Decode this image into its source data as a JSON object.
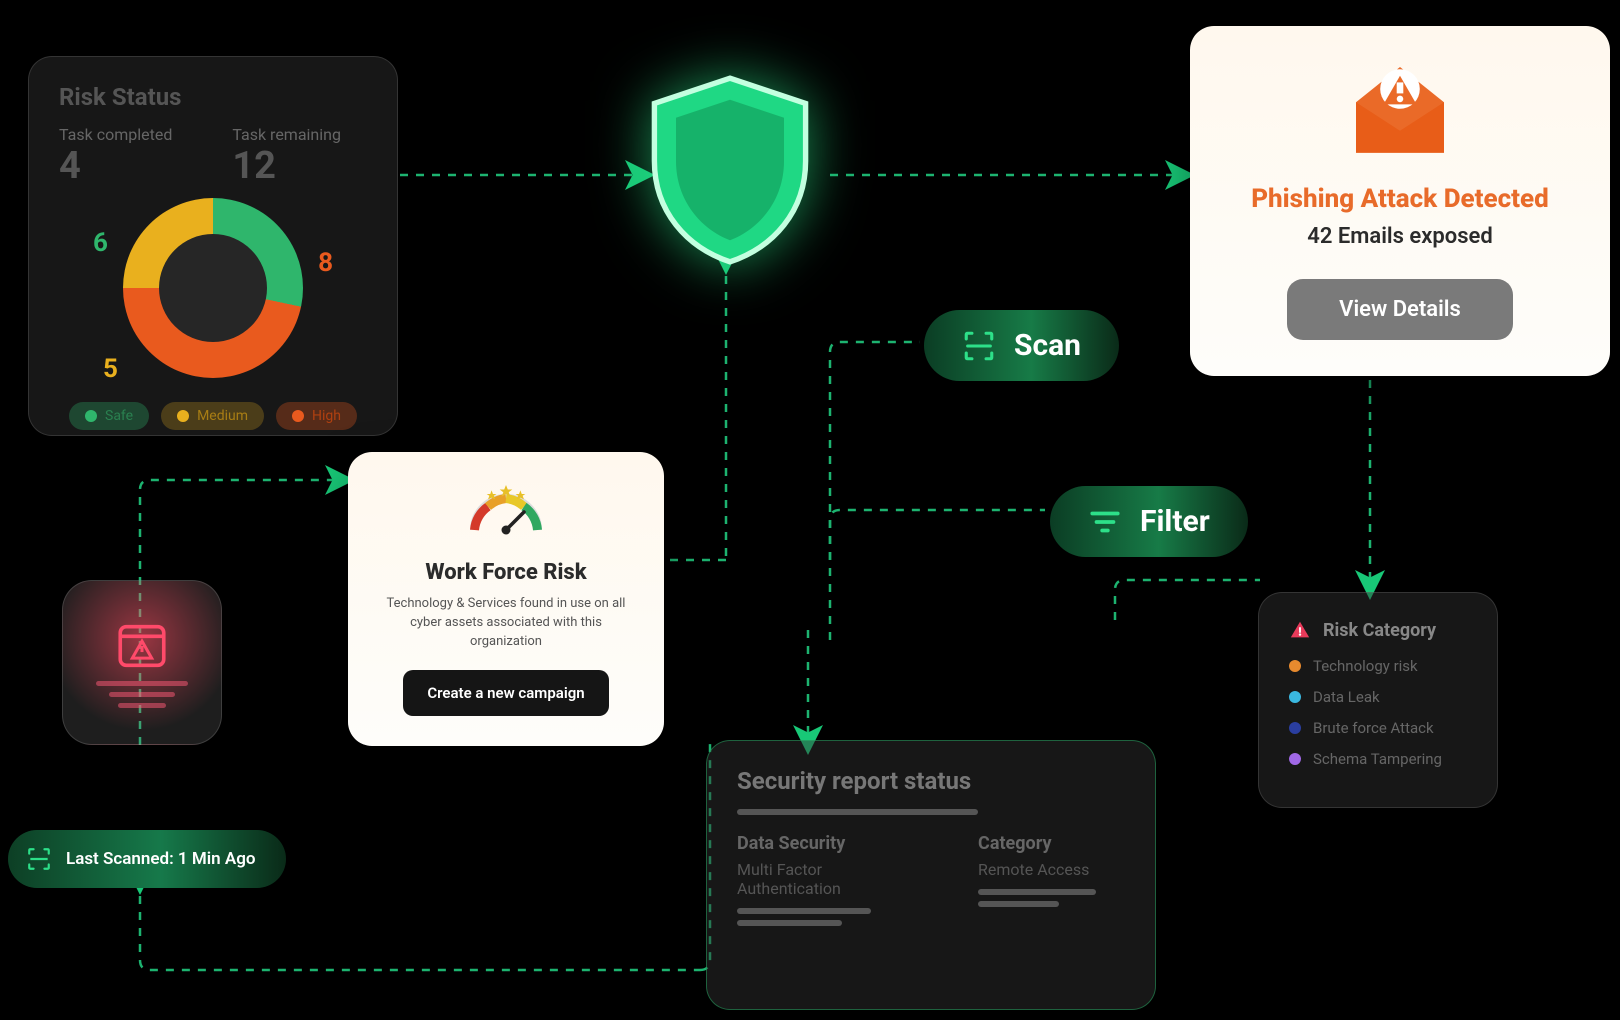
{
  "risk_status": {
    "title": "Risk Status",
    "completed_label": "Task completed",
    "completed_value": "4",
    "remaining_label": "Task remaining",
    "remaining_value": "12",
    "segments": {
      "safe": "6",
      "high": "8",
      "medium": "5"
    },
    "legend": {
      "safe": "Safe",
      "medium": "Medium",
      "high": "High"
    }
  },
  "phishing": {
    "title": "Phishing Attack Detected",
    "subtitle": "42 Emails exposed",
    "button": "View Details"
  },
  "scan": {
    "label": "Scan"
  },
  "filter": {
    "label": "Filter"
  },
  "workforce": {
    "title": "Work Force Risk",
    "desc": "Technology & Services found in use on all cyber assets associated with this organization",
    "button": "Create a new campaign"
  },
  "last_scanned": {
    "text": "Last Scanned: 1 Min Ago"
  },
  "sec_report": {
    "title": "Security report status",
    "col1_hd": "Data Security",
    "col1_txt": "Multi Factor Authentication",
    "col2_hd": "Category",
    "col2_txt": "Remote Access"
  },
  "risk_category": {
    "title": "Risk Category",
    "items": [
      {
        "label": "Technology risk",
        "color": "#e78a2e"
      },
      {
        "label": "Data Leak",
        "color": "#3ab8e0"
      },
      {
        "label": "Brute force Attack",
        "color": "#2a3ea0"
      },
      {
        "label": "Schema Tampering",
        "color": "#a068e6"
      }
    ]
  },
  "chart_data": {
    "type": "pie",
    "title": "Risk Status",
    "series": [
      {
        "name": "Safe",
        "value": 6,
        "color": "#2fb66c"
      },
      {
        "name": "High",
        "value": 8,
        "color": "#e95a1e"
      },
      {
        "name": "Medium",
        "value": 5,
        "color": "#e9b01e"
      }
    ]
  }
}
